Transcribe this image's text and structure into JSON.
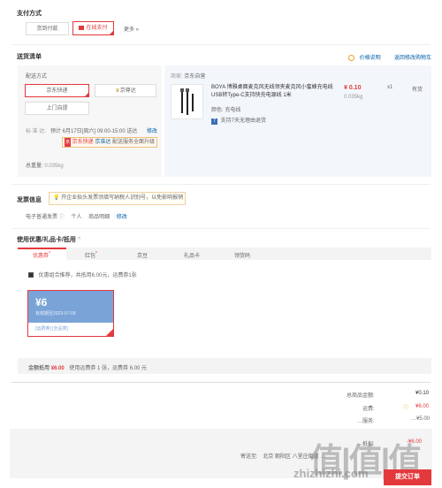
{
  "payment": {
    "title": "支付方式",
    "options": [
      "货到付款",
      "在线支付"
    ],
    "more": "更多 »"
  },
  "delivery": {
    "title": "送货清单",
    "price_link": "价格说明",
    "return_link": "返回修改购物车",
    "method_label": "配送方式",
    "methods": [
      "京东快递",
      "京尊达"
    ],
    "self_pickup": "上门自提",
    "schedule_label": "标 准 达:",
    "schedule": "预计 6月17日[周六] 09:00-15:00 送达",
    "schedule_modify": "修改",
    "tag_badge": "京",
    "tag_text": "京东快递",
    "tag_link": "京准达",
    "tag_rest": "配送服务全面升级",
    "weight_label": "总重量:",
    "weight_value": "0.035kg"
  },
  "seller": {
    "label": "商家:",
    "name": "京东自营"
  },
  "product": {
    "name": "BOYA 博雅桌面麦克风无线领夹麦克风小蜜蜂充电线USB转Type-C支持快充电源线 1米",
    "price": "¥ 0.10",
    "weight": "0.035kg",
    "qty": "x1",
    "stock": "有货",
    "spec_label": "颜色:",
    "spec_value": "充电线",
    "return_icon": "7",
    "return_text": "支持7天无理由退货"
  },
  "invoice": {
    "title": "发票信息",
    "tip": "开企业抬头发票须填写纳税人识别号，以免影响报销",
    "type": "电子普通发票",
    "person": "个人",
    "detail": "商品明细",
    "edit": "修改"
  },
  "coupons": {
    "title": "使用优惠/礼品卡/抵用",
    "caret": "^",
    "tabs": [
      "优惠券",
      "红包",
      "京豆",
      "礼品卡",
      "领货码"
    ],
    "best_text": "优惠组合推荐，共抵用6.00元，运费券1张",
    "coupon_amount": "¥6",
    "coupon_valid": "有效期至2023-07-09",
    "coupon_tags": "[运费券]  [全品类]",
    "summary_label": "金额抵用",
    "summary_amount": "¥6.00",
    "summary_text": "使用运费券 1 张，运费券 6.00 元"
  },
  "totals": {
    "total_label": "总商品金额:",
    "total_value": "¥0.10",
    "freight_label": "运费:",
    "freight_value": "¥6.00",
    "third_label": "…服务:",
    "third_value": "…¥5.00",
    "fourth_label": "…抵扣:",
    "fourth_value": "-¥6.00"
  },
  "footer": {
    "address_prefix": "寄送至:",
    "address": "北京 朝阳区 八里庄街道 …",
    "submit": "提交订单",
    "watermark": "值|值|值",
    "watermark_url": "zhizhizhi.com"
  },
  "colors": {
    "accent": "#e4393c",
    "link": "#005ea7",
    "coupon_blue": "#7aa4d8"
  }
}
